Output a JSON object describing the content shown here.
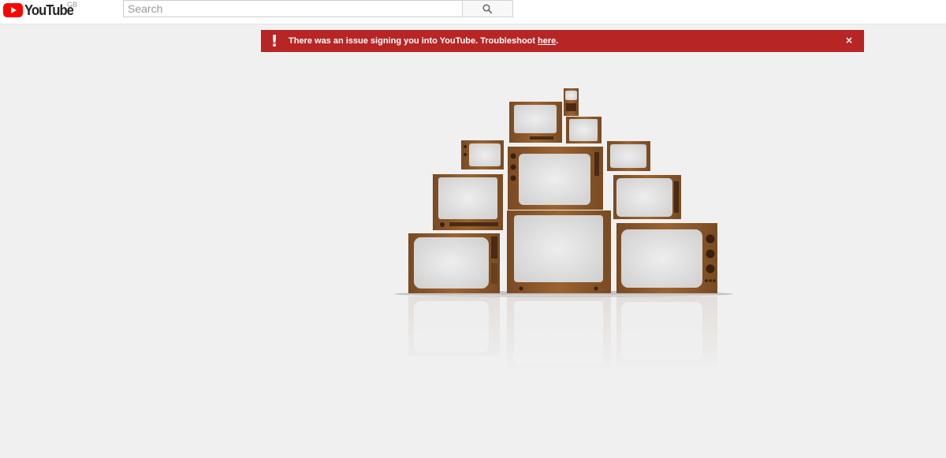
{
  "header": {
    "logo_text": "YouTube",
    "country_code": "GB",
    "search": {
      "placeholder": "Search",
      "value": ""
    }
  },
  "alert": {
    "icon_glyph": "!",
    "message": "There was an issue signing you into YouTube. Troubleshoot ",
    "link_text": "here",
    "suffix": ".",
    "close_glyph": "×",
    "background": "#b72525"
  },
  "illustration": {
    "name": "stack-of-vintage-televisions",
    "wood_color": "#8a5a2b",
    "screen_color": "#e4e4e4"
  },
  "colors": {
    "brand_red": "#ff0000",
    "page_background": "#f0f0f0"
  }
}
